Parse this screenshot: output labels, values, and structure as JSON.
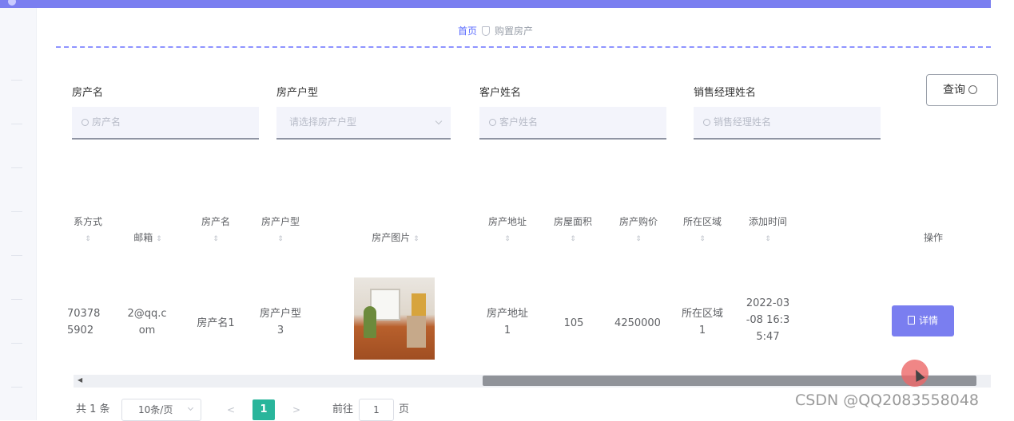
{
  "breadcrumb": {
    "home": "首页",
    "current": "购置房产"
  },
  "filters": [
    {
      "label": "房产名",
      "placeholder": "房产名"
    },
    {
      "label": "房产户型",
      "placeholder": "请选择房产户型"
    },
    {
      "label": "客户姓名",
      "placeholder": "客户姓名"
    },
    {
      "label": "销售经理姓名",
      "placeholder": "销售经理姓名"
    }
  ],
  "query_button": "查询",
  "table": {
    "headers": [
      "系方式",
      "邮箱",
      "房产名",
      "房产户型",
      "房产图片",
      "房产地址",
      "房屋面积",
      "房产购价",
      "所在区域",
      "添加时间",
      "操作"
    ],
    "row": {
      "phone": "70378\n5902",
      "email": "2@qq.c\nom",
      "name": "房产名1",
      "type": "房产户型\n3",
      "address": "房产地址\n1",
      "area": "105",
      "price": "4250000",
      "region": "所在区域\n1",
      "time": "2022-03\n-08 16:3\n5:47",
      "action": "详情"
    }
  },
  "pagination": {
    "total": "共 1 条",
    "page_size": "10条/页",
    "current_page": "1",
    "goto_label": "前往",
    "goto_value": "1",
    "page_unit": "页"
  },
  "watermark": "CSDN @QQ2083558048",
  "colors": {
    "accent": "#7a7ef0",
    "page_active": "#29b59b"
  }
}
